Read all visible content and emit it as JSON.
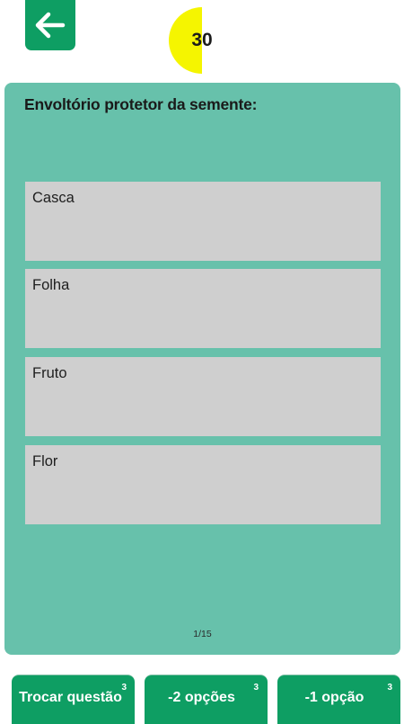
{
  "header": {
    "back_icon": "arrow-left-icon",
    "timer": {
      "value": "30",
      "color": "#f5f500"
    }
  },
  "quiz": {
    "question": "Envoltório protetor da semente:",
    "options": [
      {
        "label": "Casca"
      },
      {
        "label": "Folha"
      },
      {
        "label": "Fruto"
      },
      {
        "label": "Flor"
      }
    ],
    "progress": "1/15"
  },
  "helpers": [
    {
      "label": "Trocar questão",
      "count": "3"
    },
    {
      "label": "-2 opções",
      "count": "3"
    },
    {
      "label": "-1 opção",
      "count": "3"
    }
  ],
  "colors": {
    "accent": "#0e9e63",
    "card": "#67c1ab",
    "option": "#cfcfcf"
  }
}
